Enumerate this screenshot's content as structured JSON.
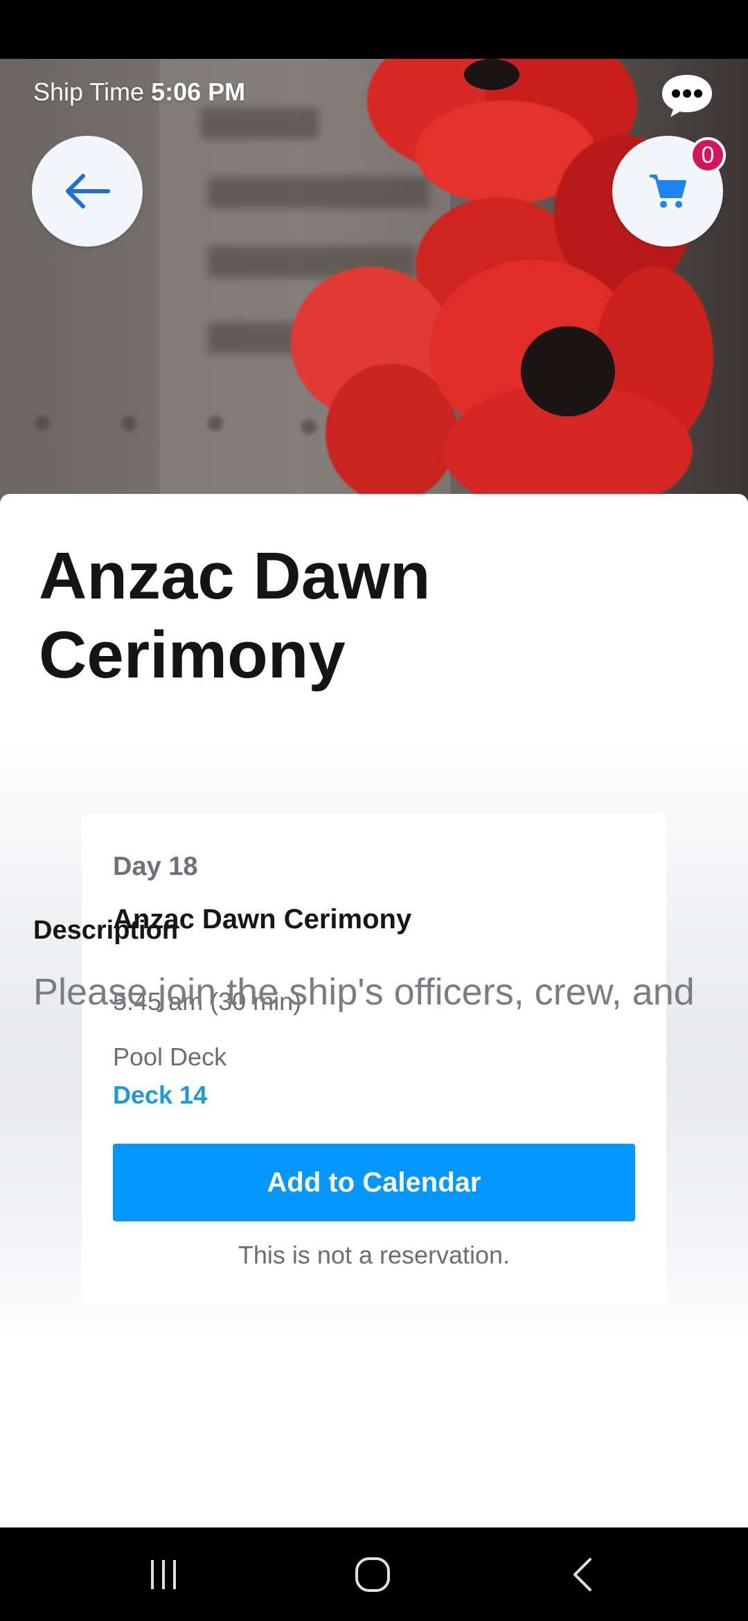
{
  "header": {
    "ship_time_label": "Ship Time",
    "ship_time_value": "5:06 PM",
    "cart_count": "0",
    "icons": {
      "back": "arrow-left-icon",
      "cart": "shopping-cart-icon",
      "chat": "chat-bubble-icon"
    }
  },
  "event": {
    "title": "Anzac Dawn Cerimony",
    "day": "Day 18",
    "name": "Anzac Dawn Cerimony",
    "time": "5:45 am (30 min)",
    "location": "Pool Deck",
    "deck": "Deck 14",
    "calendar_button": "Add to Calendar",
    "note": "This is not a reservation."
  },
  "description": {
    "heading": "Description",
    "text": "Please join the ship's officers, crew, and"
  },
  "colors": {
    "accent_blue": "#0497ff",
    "deck_link": "#1d9ad9",
    "badge": "#d6135d",
    "back_arrow": "#1f6fd6"
  },
  "nav": {
    "icons": [
      "recent-apps-icon",
      "home-icon",
      "system-back-icon"
    ]
  }
}
